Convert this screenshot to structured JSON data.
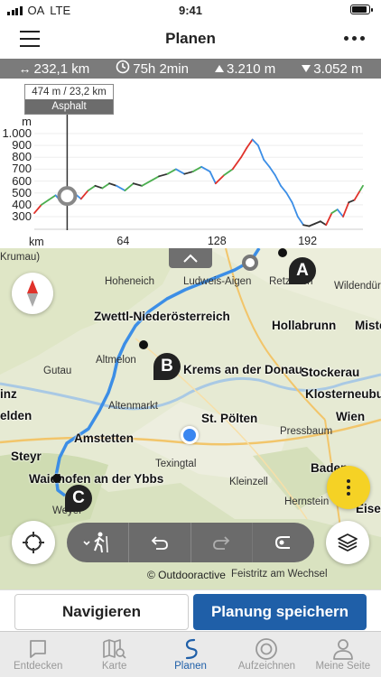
{
  "status": {
    "carrier": "OA",
    "network": "LTE",
    "time": "9:41",
    "battery_level": 0.95
  },
  "nav": {
    "title": "Planen"
  },
  "stats": {
    "distance": "232,1 km",
    "duration": "75h 2min",
    "ascent": "3.210 m",
    "descent": "3.052 m"
  },
  "tooltip": {
    "value": "474 m / 23,2 km",
    "surface": "Asphalt"
  },
  "chart_data": {
    "type": "area",
    "ylabel": "m",
    "xlabel": "km",
    "ylim": [
      200,
      1050
    ],
    "xlim": [
      0,
      232
    ],
    "y_ticks": [
      "1.000",
      "900",
      "800",
      "700",
      "600",
      "500",
      "400",
      "300"
    ],
    "x_ticks": [
      "64",
      "128",
      "192"
    ],
    "cursor_x": 23.2,
    "cursor_y": 474,
    "series": [
      {
        "x": [
          0,
          5,
          10,
          15,
          20,
          23,
          28,
          33,
          38,
          43,
          48,
          53,
          58,
          64,
          70,
          76,
          82,
          88,
          94,
          100,
          106,
          112,
          118,
          124,
          128,
          134,
          140,
          146,
          150,
          154,
          158,
          162,
          166,
          170,
          174,
          178,
          182,
          186,
          190,
          194,
          198,
          202,
          206,
          210,
          214,
          218,
          222,
          226,
          230,
          232
        ],
        "values": [
          330,
          400,
          440,
          480,
          410,
          474,
          500,
          450,
          520,
          560,
          540,
          580,
          560,
          520,
          580,
          560,
          600,
          640,
          660,
          700,
          660,
          680,
          720,
          680,
          580,
          650,
          700,
          800,
          880,
          950,
          900,
          780,
          720,
          650,
          560,
          500,
          420,
          300,
          230,
          220,
          240,
          260,
          230,
          330,
          360,
          300,
          420,
          440,
          520,
          560
        ]
      }
    ]
  },
  "map": {
    "places": [
      {
        "name": "Krumau)",
        "type": "place"
      },
      {
        "name": "Hoheneich",
        "type": "place"
      },
      {
        "name": "Ludweis-Aigen",
        "type": "place"
      },
      {
        "name": "Retzbach",
        "type": "place"
      },
      {
        "name": "Wildendürnbach",
        "type": "place"
      },
      {
        "name": "Zwettl-Niederösterreich",
        "type": "town"
      },
      {
        "name": "Hollabrunn",
        "type": "town"
      },
      {
        "name": "Misteln",
        "type": "town"
      },
      {
        "name": "Altmelon",
        "type": "place"
      },
      {
        "name": "Krems an der Donau",
        "type": "town"
      },
      {
        "name": "Gutau",
        "type": "place"
      },
      {
        "name": "Stockerau",
        "type": "town"
      },
      {
        "name": "inz",
        "type": "town"
      },
      {
        "name": "Klosterneuburg",
        "type": "town"
      },
      {
        "name": "Altenmarkt",
        "type": "place"
      },
      {
        "name": "elden",
        "type": "town"
      },
      {
        "name": "St. Pölten",
        "type": "town"
      },
      {
        "name": "Wien",
        "type": "town"
      },
      {
        "name": "Amstetten",
        "type": "town"
      },
      {
        "name": "Pressbaum",
        "type": "place"
      },
      {
        "name": "Steyr",
        "type": "town"
      },
      {
        "name": "Texingtal",
        "type": "place"
      },
      {
        "name": "Baden",
        "type": "town"
      },
      {
        "name": "Waidhofen an der Ybbs",
        "type": "town"
      },
      {
        "name": "Kleinzell",
        "type": "place"
      },
      {
        "name": "Hernstein",
        "type": "place"
      },
      {
        "name": "Eisenst",
        "type": "town"
      },
      {
        "name": "Weyer",
        "type": "place"
      },
      {
        "name": "Feistritz am Wechsel",
        "type": "place"
      }
    ],
    "markers": [
      "A",
      "B",
      "C"
    ],
    "attribution": "© Outdooractive",
    "route_color": "#3c8ee6"
  },
  "toolbar": {
    "items": [
      "hiking-profile",
      "undo",
      "redo",
      "return-to-start"
    ]
  },
  "actions": {
    "navigate": "Navigieren",
    "save": "Planung speichern"
  },
  "tabs": [
    {
      "label": "Entdecken",
      "icon": "chat-bubble-icon"
    },
    {
      "label": "Karte",
      "icon": "map-search-icon"
    },
    {
      "label": "Planen",
      "icon": "route-icon",
      "active": true
    },
    {
      "label": "Aufzeichnen",
      "icon": "record-icon"
    },
    {
      "label": "Meine Seite",
      "icon": "user-icon"
    }
  ],
  "colors": {
    "accent": "#1f5fa8",
    "fab": "#f5d225",
    "stats_bg": "#7b7b7b"
  }
}
